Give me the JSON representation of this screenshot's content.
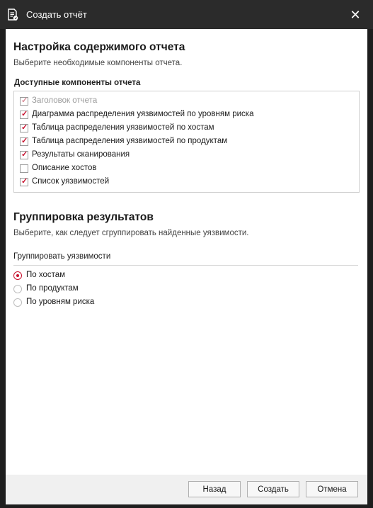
{
  "window": {
    "title": "Создать отчёт",
    "icon": "report-document-icon",
    "close_glyph": "✕"
  },
  "content": {
    "heading": "Настройка содержимого отчета",
    "description": "Выберите необходимые компоненты отчета.",
    "components_label": "Доступные компоненты отчета",
    "components": [
      {
        "label": "Заголовок отчета",
        "checked": true,
        "disabled": true
      },
      {
        "label": "Диаграмма распределения уязвимостей по уровням риска",
        "checked": true,
        "disabled": false
      },
      {
        "label": "Таблица распределения уязвимостей по хостам",
        "checked": true,
        "disabled": false
      },
      {
        "label": "Таблица распределения уязвимостей по продуктам",
        "checked": true,
        "disabled": false
      },
      {
        "label": "Результаты сканирования",
        "checked": true,
        "disabled": false
      },
      {
        "label": "Описание хостов",
        "checked": false,
        "disabled": false
      },
      {
        "label": "Список уязвимостей",
        "checked": true,
        "disabled": false
      }
    ]
  },
  "grouping": {
    "heading": "Группировка результатов",
    "description": "Выберите, как следует сгруппировать найденные уязвимости.",
    "group_label": "Группировать уязвимости",
    "options": [
      {
        "label": "По хостам",
        "selected": true
      },
      {
        "label": "По продуктам",
        "selected": false
      },
      {
        "label": "По уровням риска",
        "selected": false
      }
    ]
  },
  "footer": {
    "back_label": "Назад",
    "create_label": "Создать",
    "cancel_label": "Отмена"
  },
  "colors": {
    "accent": "#c8102e",
    "titlebar": "#2b2b2b",
    "footer": "#f0f0f0"
  }
}
